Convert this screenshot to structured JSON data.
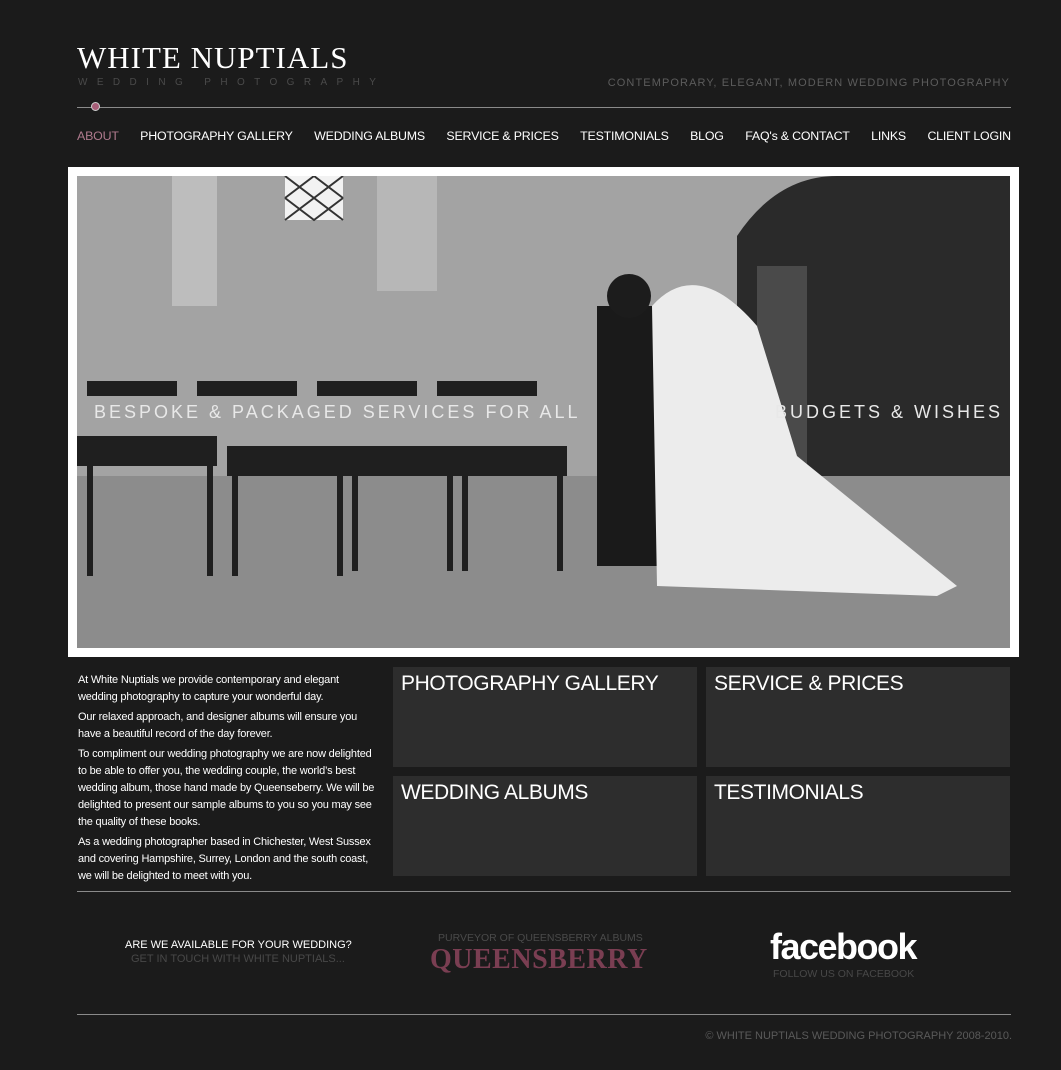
{
  "header": {
    "logo_title": "WHITE NUPTIALS",
    "logo_subtitle": "WEDDING PHOTOGRAPHY",
    "tagline": "CONTEMPORARY, ELEGANT, MODERN WEDDING PHOTOGRAPHY"
  },
  "nav": [
    {
      "label": "ABOUT",
      "active": true
    },
    {
      "label": "PHOTOGRAPHY GALLERY"
    },
    {
      "label": "WEDDING ALBUMS"
    },
    {
      "label": "SERVICE & PRICES"
    },
    {
      "label": "TESTIMONIALS"
    },
    {
      "label": "BLOG"
    },
    {
      "label": "FAQ's & CONTACT"
    },
    {
      "label": "LINKS"
    },
    {
      "label": "CLIENT LOGIN"
    }
  ],
  "hero": {
    "caption_left": "BESPOKE & PACKAGED SERVICES FOR ALL",
    "caption_right": "BUDGETS & WISHES"
  },
  "intro": [
    "At White Nuptials we provide contemporary and elegant wedding photography to capture your wonderful day.",
    "Our relaxed approach, and designer albums will ensure you have a beautiful record of the day forever.",
    "To compliment our wedding photography we are now delighted to be able to offer you, the wedding couple, the world’s best wedding album, those hand made by Queenseberry. We will be delighted to present our sample albums to you so you may see the quality of these books.",
    "As a wedding photographer based in Chichester, West Sussex and covering Hampshire, Surrey, London and the south coast, we will be delighted to meet with you."
  ],
  "tiles": [
    {
      "label": "PHOTOGRAPHY GALLERY"
    },
    {
      "label": "SERVICE & PRICES"
    },
    {
      "label": "WEDDING ALBUMS"
    },
    {
      "label": "TESTIMONIALS"
    }
  ],
  "footer": {
    "availability_question": "ARE WE AVAILABLE FOR YOUR WEDDING?",
    "availability_link": "GET IN TOUCH WITH WHITE NUPTIALS...",
    "queensberry_caption": "PURVEYOR OF QUEENSBERRY ALBUMS",
    "queensberry_logo": "QUEENSBERRY",
    "facebook_logo": "facebook",
    "facebook_caption": "FOLLOW US ON FACEBOOK",
    "copyright": "© WHITE NUPTIALS WEDDING PHOTOGRAPHY 2008-2010."
  },
  "colors": {
    "background": "#1b1b1b",
    "accent": "#a75e78",
    "queensberry": "#7a3e52",
    "tile": "#2d2d2d"
  }
}
